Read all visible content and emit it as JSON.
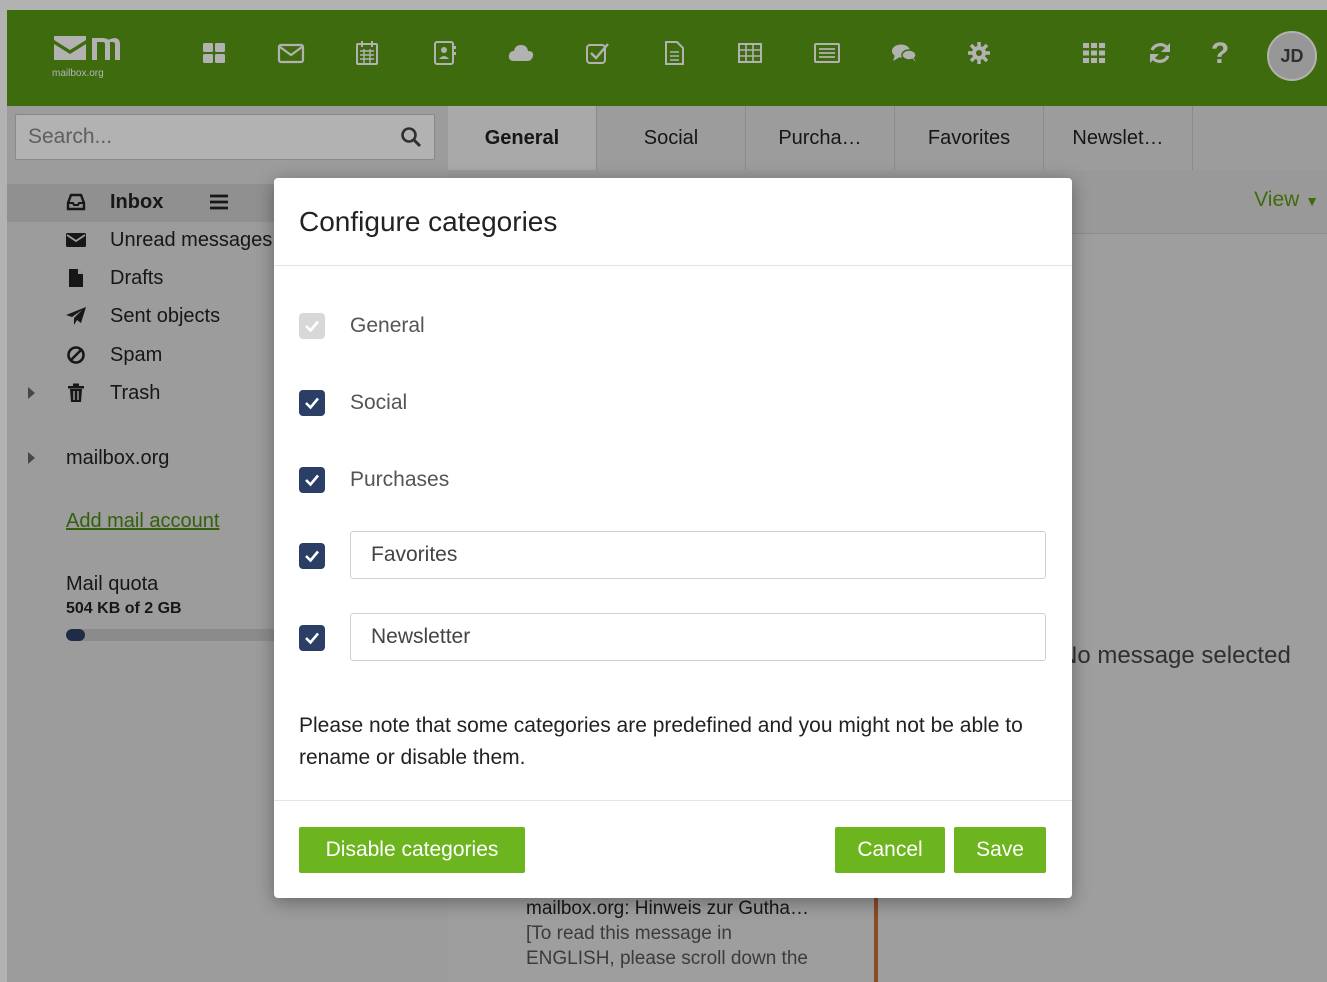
{
  "topbar": {
    "logo_text": "mailbox.org",
    "apps": [
      "portal-icon",
      "mail-icon",
      "calendar-icon",
      "contacts-icon",
      "drive-icon",
      "tasks-icon",
      "documents-icon",
      "spreadsheet-icon",
      "presentation-icon",
      "chat-icon",
      "settings-icon"
    ],
    "avatar_initials": "JD",
    "colors": {
      "bar": "#5b9a16",
      "accent_button": "#6cb51f",
      "checkbox": "#2b3f66"
    }
  },
  "sidebar": {
    "search_placeholder": "Search...",
    "folders": [
      {
        "label": "Inbox",
        "icon": "inbox-icon"
      },
      {
        "label": "Unread messages",
        "icon": "envelope-icon"
      },
      {
        "label": "Drafts",
        "icon": "file-icon"
      },
      {
        "label": "Sent objects",
        "icon": "paper-plane-icon"
      },
      {
        "label": "Spam",
        "icon": "ban-icon"
      },
      {
        "label": "Trash",
        "icon": "trash-icon"
      }
    ],
    "account": "mailbox.org",
    "add_account": "Add mail account",
    "quota_label": "Mail quota",
    "quota_value": "504 KB of 2 GB",
    "quota_fraction": 0.0002
  },
  "tabs": [
    "General",
    "Social",
    "Purcha…",
    "Favorites",
    "Newslet…"
  ],
  "content": {
    "view_label": "View",
    "detail_message": "No message selected",
    "preview": {
      "subject": "mailbox.org: Hinweis zur Gutha…",
      "line1": "[To read this message in",
      "line2": "ENGLISH, please scroll down the"
    }
  },
  "modal": {
    "title": "Configure categories",
    "categories": [
      {
        "label": "General",
        "checked": true,
        "disabled": true
      },
      {
        "label": "Social",
        "checked": true,
        "disabled": false
      },
      {
        "label": "Purchases",
        "checked": true,
        "disabled": false
      },
      {
        "value": "Favorites",
        "checked": true,
        "editable": true
      },
      {
        "value": "Newsletter",
        "checked": true,
        "editable": true
      }
    ],
    "note": "Please note that some categories are predefined and you might not be able to rename or disable them.",
    "buttons": {
      "disable": "Disable categories",
      "cancel": "Cancel",
      "save": "Save"
    }
  }
}
